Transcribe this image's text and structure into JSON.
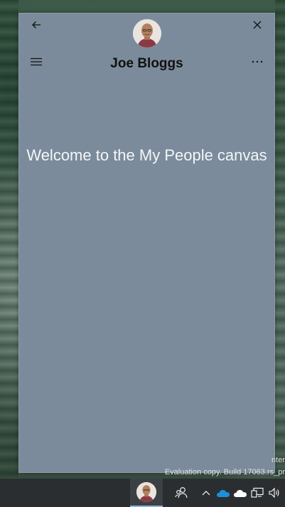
{
  "window": {
    "contact_name": "Joe Bloggs",
    "welcome_text": "Welcome to the My People canvas"
  },
  "icons": {
    "back": "back-arrow-icon",
    "close": "close-icon",
    "menu": "hamburger-menu-icon",
    "more": "more-options-icon"
  },
  "watermark": {
    "line1": "nter",
    "line2": "Evaluation copy. Build 17063.rs_pr"
  },
  "taskbar": {
    "items": [
      "pinned-contact-avatar",
      "people-icon",
      "show-hidden-icons-chevron",
      "onedrive-icon",
      "cloud-icon",
      "network-icon",
      "volume-icon"
    ]
  },
  "colors": {
    "canvas_bg": "#7b8b9b",
    "taskbar_bg": "#2b2e30",
    "onedrive_blue": "#1e8fd9"
  }
}
